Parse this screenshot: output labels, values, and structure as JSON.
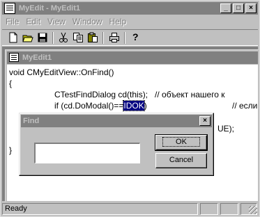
{
  "app": {
    "title": "MyEdit - MyEdit1",
    "caption_buttons": {
      "minimize": "_",
      "maximize": "□",
      "close": "×"
    }
  },
  "menu": {
    "items": [
      "File",
      "Edit",
      "View",
      "Window",
      "Help"
    ]
  },
  "toolbar": {
    "buttons": [
      {
        "name": "new-icon"
      },
      {
        "name": "open-icon"
      },
      {
        "name": "save-icon"
      },
      {
        "name": "cut-icon"
      },
      {
        "name": "copy-icon"
      },
      {
        "name": "paste-icon"
      },
      {
        "name": "print-icon"
      },
      {
        "name": "help-icon",
        "label": "?"
      }
    ]
  },
  "child": {
    "title": "MyEdit1",
    "code": {
      "l1": "void CMyEditView::OnFind()",
      "l2": "{",
      "l3": "CTestFindDialog cd(this);   // объект нашего к",
      "l4_pre": "if (cd.DoModal()==",
      "l4_sel": "IDOK",
      "l4_post": ")",
      "l4_comment": "// если",
      "l5_fragment": "UE);",
      "l6": "}"
    }
  },
  "dialog": {
    "title": "Find",
    "close": "×",
    "input_value": "",
    "ok_label": "OK",
    "cancel_label": "Cancel"
  },
  "status": {
    "text": "Ready"
  }
}
